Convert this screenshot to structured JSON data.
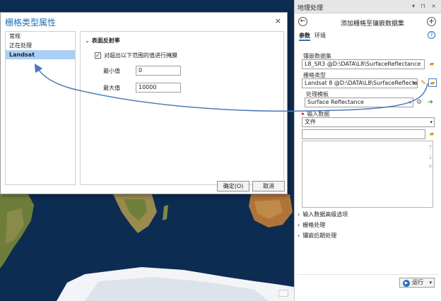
{
  "dialog": {
    "title": "栅格类型属性",
    "close": "×",
    "nav_items": [
      {
        "label": "常规"
      },
      {
        "label": "正在处理"
      },
      {
        "label": "Landsat"
      }
    ],
    "section_title": "表面反射率",
    "checkbox_label": "对超出以下范围的值进行掩膜",
    "checkbox_checked": true,
    "min_label": "最小值",
    "min_value": "0",
    "max_label": "最大值",
    "max_value": "10000",
    "ok_label": "确定(O)",
    "cancel_label": "取消"
  },
  "gp_panel": {
    "header_title": "地理处理",
    "header_controls": "▾ ⊓ ×",
    "tool_title": "添加栅格至镶嵌数据集",
    "tabs": [
      "参数",
      "环境"
    ],
    "help": "?",
    "mosaic_label": "镶嵌数据集",
    "mosaic_value": "L8_SR3 @D:\\DATA\\L8\\SurfaceReflectance",
    "raster_type_label": "栅格类型",
    "raster_type_value": "Landsat 8 @D:\\DATA\\L8\\SurfaceReflecta",
    "template_label": "处理模板",
    "template_value": "Surface Reflectance",
    "input_label": "输入数据",
    "input_type_value": "文件",
    "expanders": [
      "输入数据高级选项",
      "栅格处理",
      "镶嵌后期处理"
    ],
    "run_label": "运行"
  },
  "colors": {
    "title_blue": "#1f6fb5",
    "selection": "#a9d0f5",
    "arrow": "#4a7ab8",
    "ocean": "#0b2a4d"
  }
}
